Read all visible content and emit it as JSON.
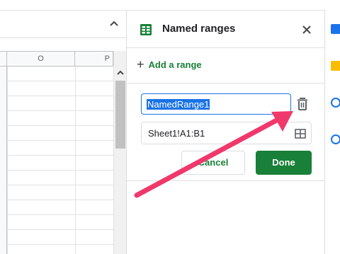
{
  "sheet": {
    "column_headers": [
      "",
      "O",
      "P"
    ]
  },
  "panel": {
    "title": "Named ranges",
    "add_range_label": "Add a range",
    "range_name_value": "NamedRange1",
    "range_ref_value": "Sheet1!A1:B1",
    "cancel_label": "Cancel",
    "done_label": "Done"
  },
  "icons": {
    "panel_title": "sheets-grid-icon",
    "close": "close-icon",
    "add": "plus-icon",
    "delete": "trash-icon",
    "select_range": "grid-select-icon",
    "collapse": "chevron-up-icon"
  },
  "colors": {
    "accent_green": "#188038",
    "focus_blue": "#1a73e8",
    "arrow_pink": "#f0386b",
    "side_blue": "#1a73e8",
    "side_yellow": "#fbbc04"
  }
}
